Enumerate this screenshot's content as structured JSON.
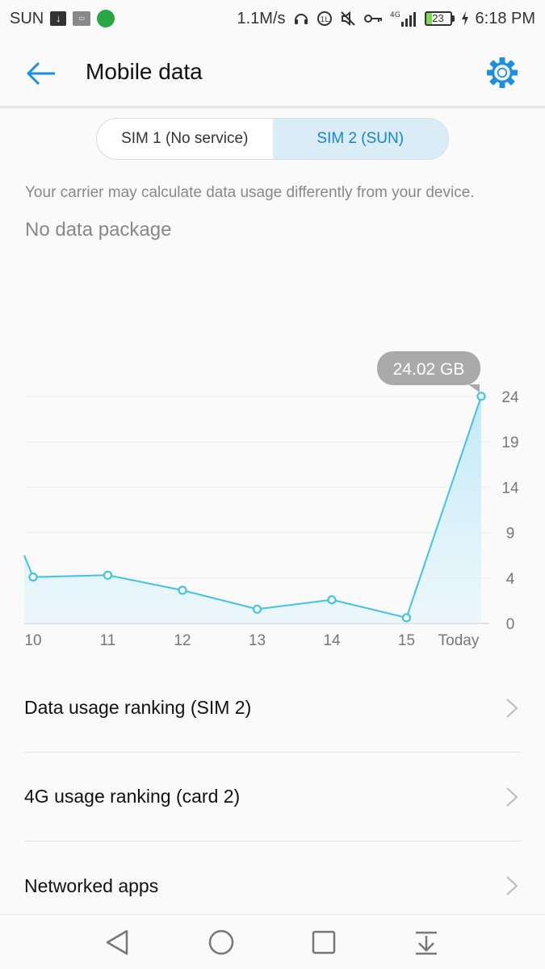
{
  "status_bar": {
    "carrier": "SUN",
    "speed": "1.1M/s",
    "network": "4G",
    "battery": "23",
    "time": "6:18 PM",
    "icons": [
      "download-icon",
      "notification-icon",
      "vpn-shield-icon",
      "headset-icon",
      "data-saver-icon",
      "mute-icon",
      "key-icon",
      "signal-icon",
      "battery-icon",
      "charging-icon"
    ]
  },
  "app_bar": {
    "title": "Mobile data"
  },
  "sim_toggle": {
    "sim1_label": "SIM 1 (No service)",
    "sim2_label": "SIM 2 (SUN)",
    "selected": "sim2"
  },
  "notice": "Your carrier may calculate data usage differently from your device.",
  "package_status": "No data package",
  "chart_data": {
    "type": "area",
    "title": "",
    "xlabel": "",
    "ylabel": "",
    "categories": [
      "10",
      "11",
      "12",
      "13",
      "14",
      "15",
      "Today"
    ],
    "values": [
      4.9,
      5.1,
      3.5,
      1.5,
      2.5,
      0.6,
      24.02
    ],
    "ylim": [
      0,
      24
    ],
    "yticks": [
      "0",
      "4",
      "9",
      "14",
      "19",
      "24"
    ],
    "highlight_label": "24.02 GB",
    "grid": true,
    "colors": {
      "line": "#41c3e6",
      "fill": "#bfe8f6"
    }
  },
  "list": [
    {
      "label": "Data usage ranking (SIM 2)"
    },
    {
      "label": "4G usage ranking (card 2)"
    },
    {
      "label": "Networked apps"
    }
  ],
  "accent_color": "#1c8fe0"
}
